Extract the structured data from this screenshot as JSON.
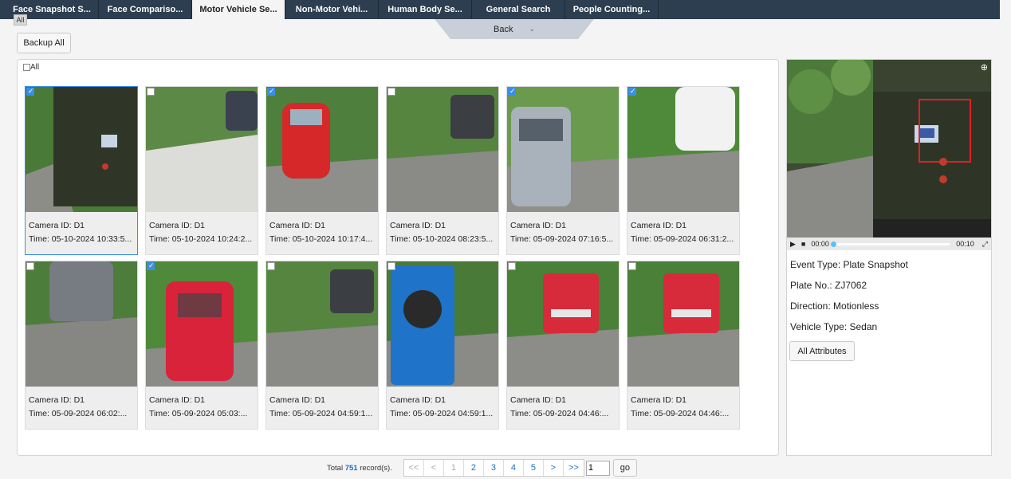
{
  "tabs": [
    {
      "label": "Face Snapshot S...",
      "active": false
    },
    {
      "label": "Face Compariso...",
      "active": false
    },
    {
      "label": "Motor Vehicle Se...",
      "active": true
    },
    {
      "label": "Non-Motor Vehi...",
      "active": false
    },
    {
      "label": "Human Body Se...",
      "active": false
    },
    {
      "label": "General Search",
      "active": false
    },
    {
      "label": "People Counting...",
      "active": false
    }
  ],
  "tooltip_all": "All",
  "back": {
    "label": "Back",
    "icon": "chevron-down-icon"
  },
  "backup_label": "Backup All",
  "select_all_label": "All",
  "cards": [
    {
      "camera": "Camera ID: D1",
      "time": "Time: 05-10-2024 10:33:5...",
      "checked": true,
      "selected": true,
      "scene": "truck"
    },
    {
      "camera": "Camera ID: D1",
      "time": "Time: 05-10-2024 10:24:2...",
      "checked": false,
      "selected": false,
      "scene": "bright"
    },
    {
      "camera": "Camera ID: D1",
      "time": "Time: 05-10-2024 10:17:4...",
      "checked": true,
      "selected": false,
      "scene": "red"
    },
    {
      "camera": "Camera ID: D1",
      "time": "Time: 05-10-2024 08:23:5...",
      "checked": false,
      "selected": false,
      "scene": "road"
    },
    {
      "camera": "Camera ID: D1",
      "time": "Time: 05-09-2024 07:16:5...",
      "checked": true,
      "selected": false,
      "scene": "silver"
    },
    {
      "camera": "Camera ID: D1",
      "time": "Time: 05-09-2024 06:31:2...",
      "checked": true,
      "selected": false,
      "scene": "white"
    },
    {
      "camera": "Camera ID: D1",
      "time": "Time: 05-09-2024 06:02:...",
      "checked": false,
      "selected": false,
      "scene": "gray"
    },
    {
      "camera": "Camera ID: D1",
      "time": "Time: 05-09-2024 05:03:...",
      "checked": true,
      "selected": false,
      "scene": "redsuv"
    },
    {
      "camera": "Camera ID: D1",
      "time": "Time: 05-09-2024 04:59:1...",
      "checked": false,
      "selected": false,
      "scene": "road"
    },
    {
      "camera": "Camera ID: D1",
      "time": "Time: 05-09-2024 04:59:1...",
      "checked": false,
      "selected": false,
      "scene": "blue"
    },
    {
      "camera": "Camera ID: D1",
      "time": "Time: 05-09-2024 04:46:...",
      "checked": false,
      "selected": false,
      "scene": "redtruck"
    },
    {
      "camera": "Camera ID: D1",
      "time": "Time: 05-09-2024 04:46:...",
      "checked": false,
      "selected": false,
      "scene": "redtruck"
    }
  ],
  "pagination": {
    "total_prefix": "Total",
    "total_count": "751",
    "total_suffix": "record(s).",
    "first": "<<",
    "prev": "<",
    "pages": [
      "1",
      "2",
      "3",
      "4",
      "5"
    ],
    "current_page": "1",
    "next": ">",
    "last": ">>",
    "input_value": "1",
    "go_label": "go"
  },
  "detail": {
    "player": {
      "current": "00:00",
      "duration": "00:10",
      "progress": 0
    },
    "event_type": "Event Type:  Plate Snapshot",
    "plate_no": "Plate No.:  ZJ7062",
    "direction": "Direction:  Motionless",
    "vehicle_type": "Vehicle Type:  Sedan",
    "all_attributes_label": "All Attributes"
  },
  "colors": {
    "tabbar": "#2d3e50",
    "accent": "#3a8ee6",
    "link": "#1a6fc4",
    "highlight_box": "#e02020"
  }
}
